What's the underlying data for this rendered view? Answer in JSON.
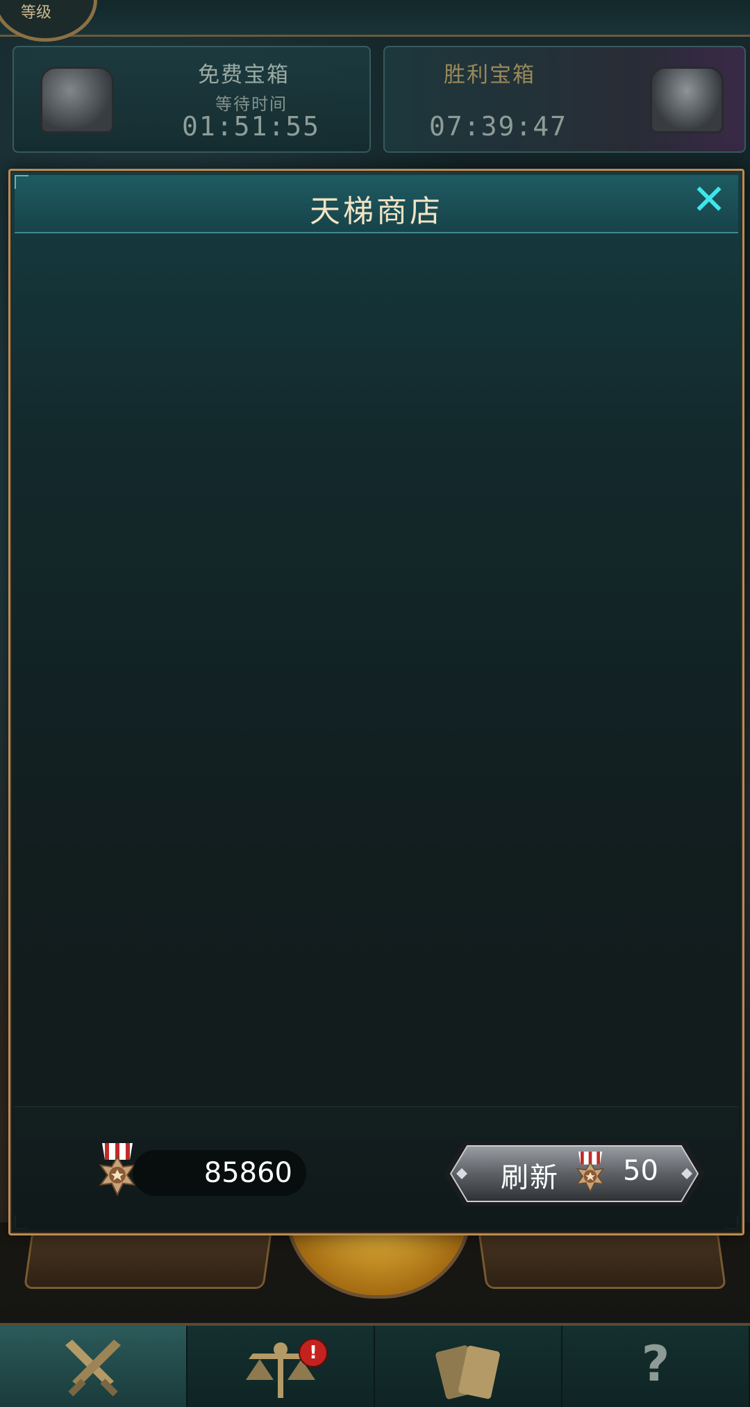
{
  "background": {
    "level_label": "等级",
    "free_chest": {
      "title": "免费宝箱",
      "subtitle": "等待时间",
      "timer": "01:51:55"
    },
    "victory_chest": {
      "title": "胜利宝箱",
      "timer": "07:39:47"
    },
    "nav_tabs": [
      {
        "icon": "crossed-swords-icon",
        "active": true
      },
      {
        "icon": "scales-icon",
        "badge": "!"
      },
      {
        "icon": "cards-icon"
      },
      {
        "icon": "question-icon",
        "glyph": "?"
      }
    ]
  },
  "modal": {
    "title": "天梯商店",
    "close_icon": "close-icon",
    "balance": {
      "icon": "ladder-medal-icon",
      "value": "85860"
    },
    "refresh_button": {
      "label": "刷新",
      "icon": "ladder-medal-icon",
      "cost": "50"
    }
  },
  "colors": {
    "accent_cyan": "#3ee6e9",
    "frame_gold": "#b98c57",
    "title_text": "#f1e4c4"
  }
}
